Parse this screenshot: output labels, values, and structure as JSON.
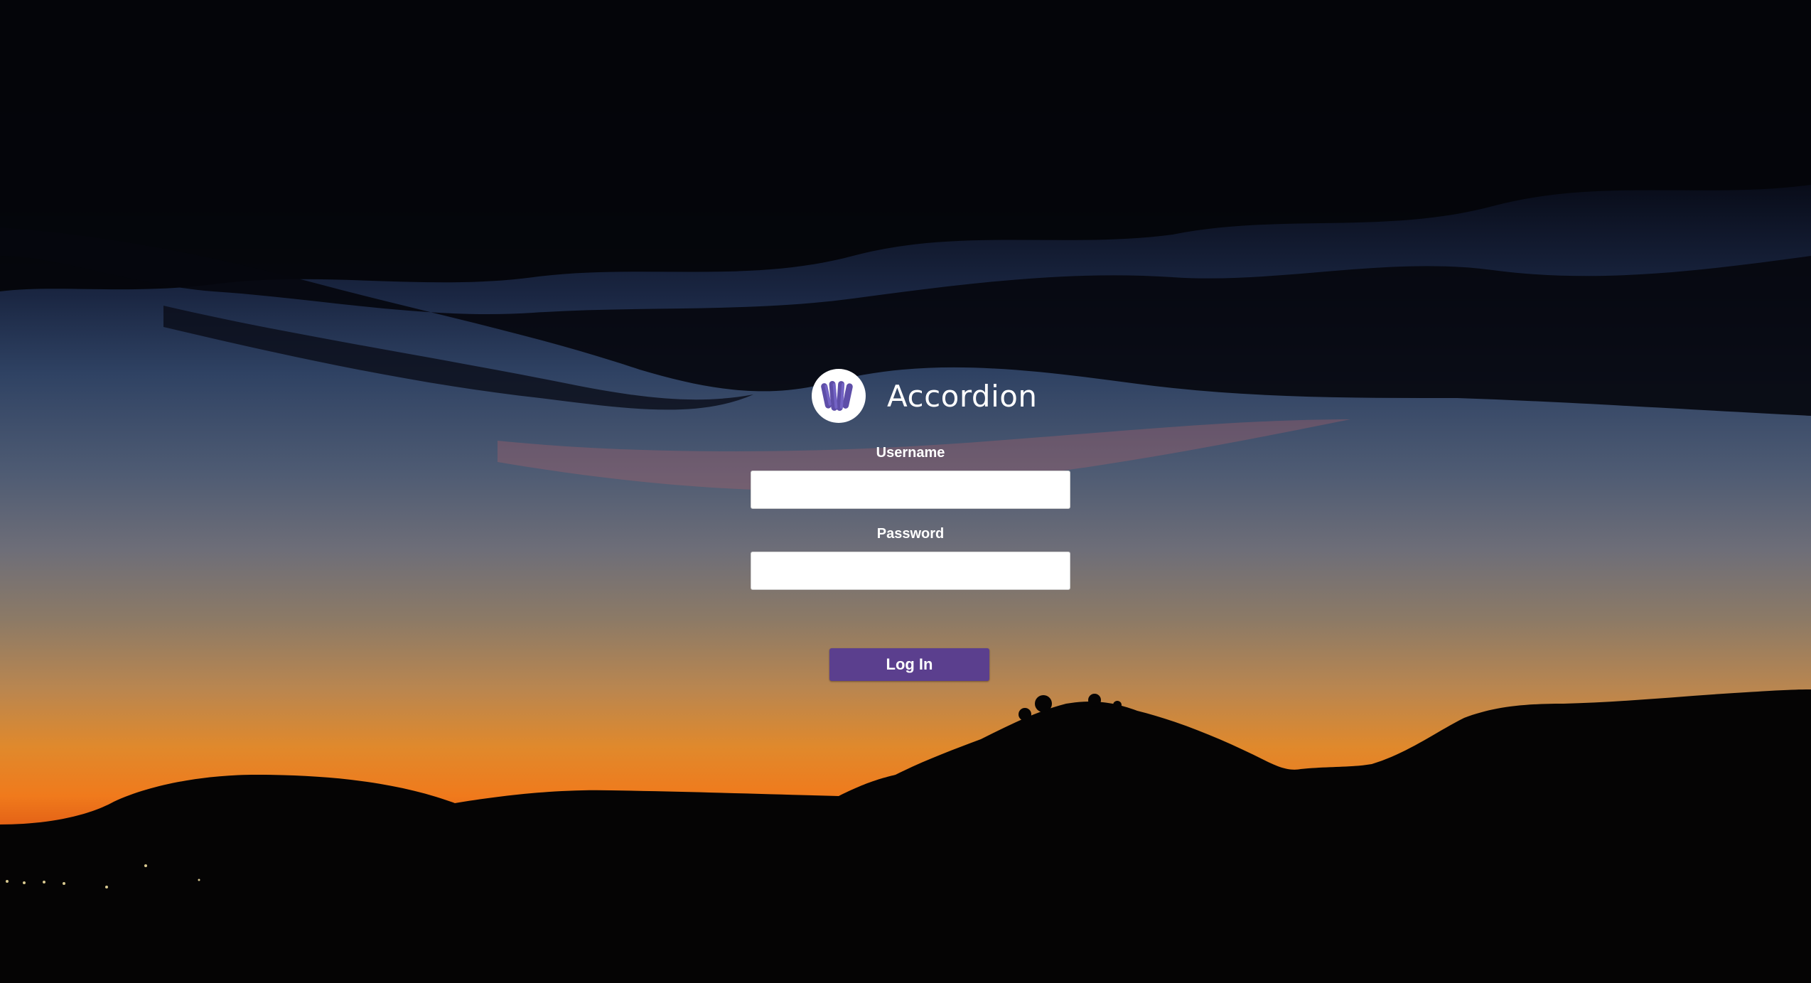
{
  "app": {
    "name": "Accordion",
    "logo_icon": "accordion-icon",
    "accent_color": "#5b3f8e"
  },
  "login_form": {
    "username_label": "Username",
    "username_value": "",
    "password_label": "Password",
    "password_value": "",
    "submit_label": "Log In"
  },
  "background": {
    "description_icon": "sunset-landscape-image"
  }
}
